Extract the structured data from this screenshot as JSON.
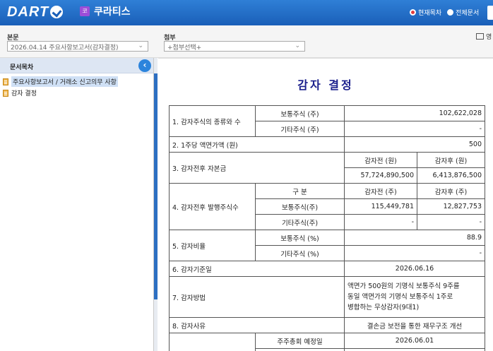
{
  "header": {
    "logo": "DART",
    "company_badge": "코",
    "company_name": "쿠라티스",
    "view_current": "현재목차",
    "view_all": "전체문서"
  },
  "toolbar": {
    "main_label": "본문",
    "main_select": "2026.04.14  주요사항보고서(감자결정)",
    "attach_label": "첨부",
    "attach_select": "+첨부선택+",
    "right_text": "영"
  },
  "sidebar": {
    "title": "문서목차",
    "collapse_icon": "chevron-left",
    "items": [
      {
        "label": "주요사항보고서 / 거래소 신고의무 사항"
      },
      {
        "label": "감자 결정"
      }
    ]
  },
  "document": {
    "title": "감자 결정",
    "rows": {
      "r1_label": "1. 감자주식의 종류와 수",
      "r1_sub1": "보통주식 (주)",
      "r1_val1": "102,622,028",
      "r1_sub2": "기타주식 (주)",
      "r1_val2": "-",
      "r2_label": "2. 1주당 액면가액 (원)",
      "r2_val": "500",
      "r3_label": "3. 감자전후 자본금",
      "r3_h1": "감자전 (원)",
      "r3_h2": "감자후 (원)",
      "r3_v1": "57,724,890,500",
      "r3_v2": "6,413,876,500",
      "r4_label": "4. 감자전후 발행주식수",
      "r4_h0": "구      분",
      "r4_h1": "감자전 (주)",
      "r4_h2": "감자후 (주)",
      "r4_sub1": "보통주식(주)",
      "r4_a1": "115,449,781",
      "r4_b1": "12,827,753",
      "r4_sub2": "기타주식(주)",
      "r4_a2": "-",
      "r4_b2": "-",
      "r5_label": "5. 감자비율",
      "r5_sub1": "보통주식 (%)",
      "r5_val1": "88.9",
      "r5_sub2": "기타주식 (%)",
      "r5_val2": "-",
      "r6_label": "6. 감자기준일",
      "r6_val": "2026.06.16",
      "r7_label": "7. 감자방법",
      "r7_line1": "액면가 500원의 기명식 보통주식 9주를",
      "r7_line2": "동일 액면가의 기명식 보통주식 1주로",
      "r7_line3": "병합하는 무상감자(9대1)",
      "r8_label": "8. 감자사유",
      "r8_val": "결손금 보전을 통한 재무구조 개선",
      "r9_sub": "주주총회 예정일",
      "r9_val": "2026.06.01"
    }
  }
}
